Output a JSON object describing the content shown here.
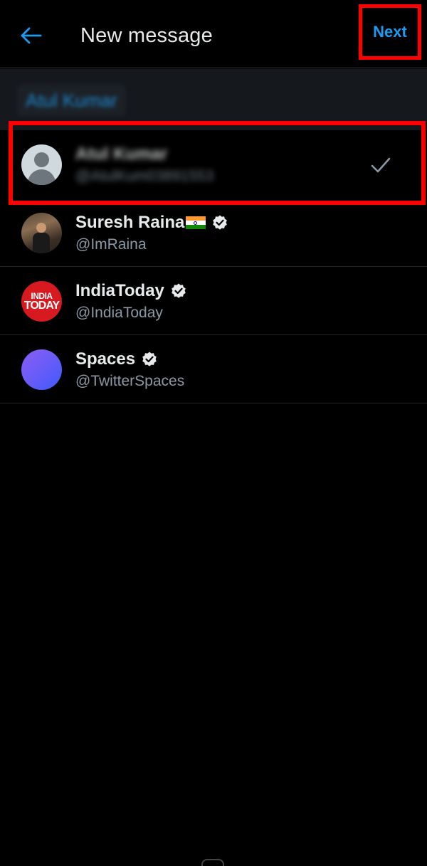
{
  "header": {
    "title": "New message",
    "next_label": "Next"
  },
  "chip": {
    "label": "Atul Kumar"
  },
  "contacts": [
    {
      "name": "Atul Kumar",
      "handle": "@AtulKum03891553",
      "selected": true,
      "avatar_icon": "default-avatar-icon"
    },
    {
      "name": "Suresh Raina",
      "handle": "@ImRaina",
      "verified": true,
      "flag": "india-flag-icon"
    },
    {
      "name": "IndiaToday",
      "handle": "@IndiaToday",
      "verified": true,
      "avatar_text_line1": "INDIA",
      "avatar_text_line2": "TODAY"
    },
    {
      "name": "Spaces",
      "handle": "@TwitterSpaces",
      "verified": true
    }
  ],
  "colors": {
    "accent": "#1d9bf0",
    "highlight": "#ff0000",
    "background": "#000000"
  }
}
